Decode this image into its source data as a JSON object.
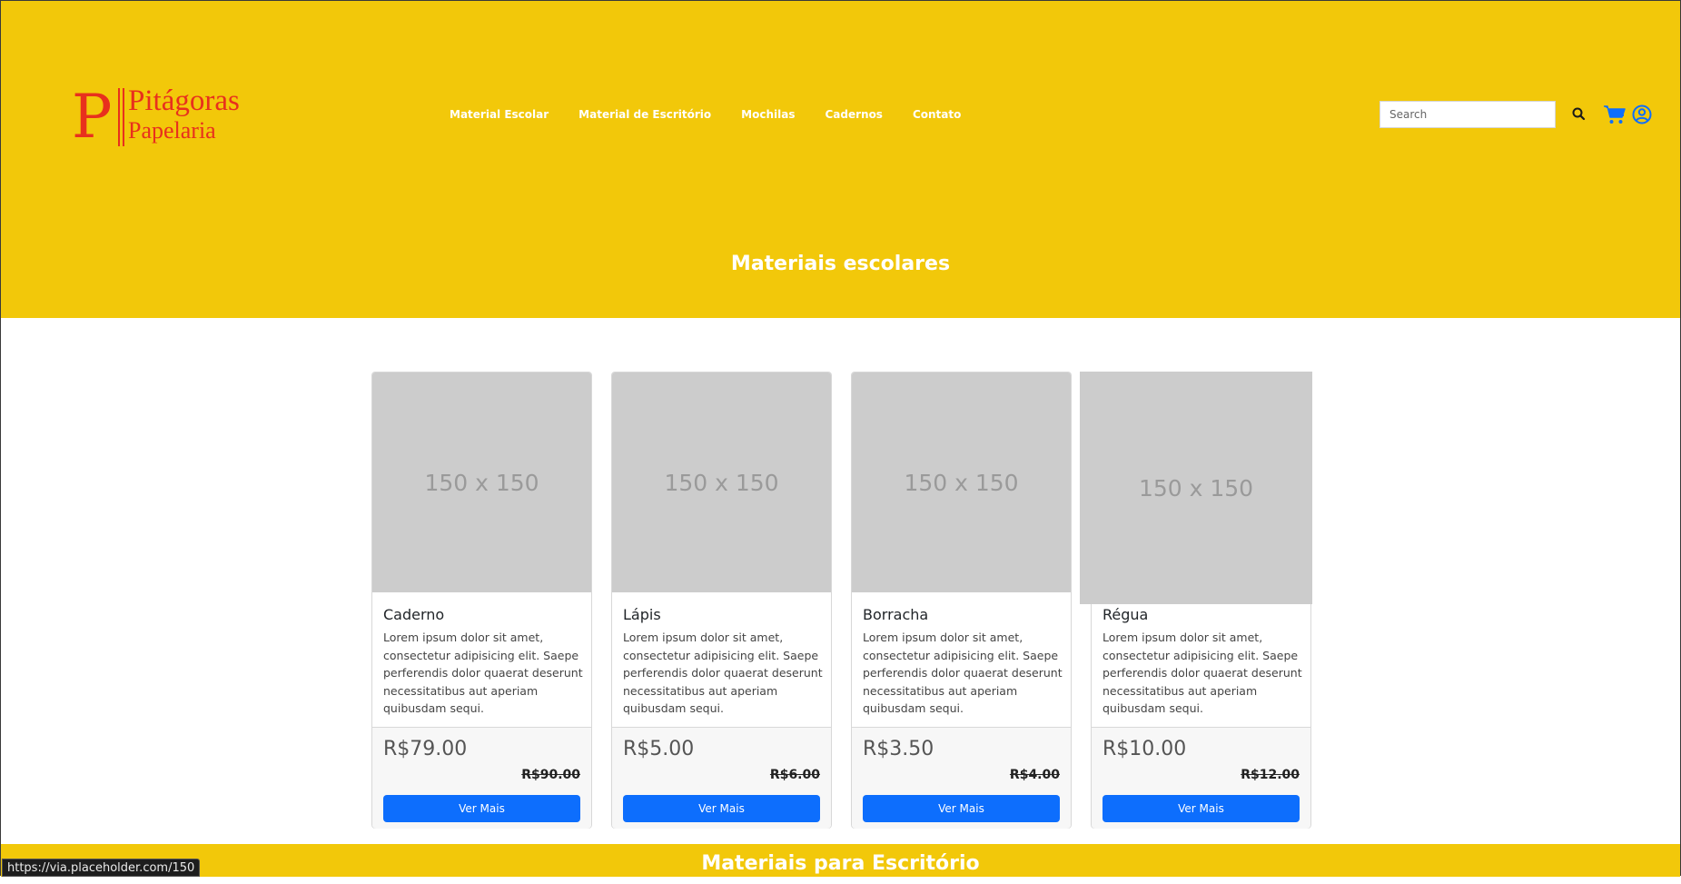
{
  "brand": {
    "letter": "P",
    "line1": "Pitágoras",
    "line2": "Papelaria",
    "color": "#e8301d"
  },
  "nav": {
    "items": [
      {
        "label": "Material Escolar"
      },
      {
        "label": "Material de Escritório"
      },
      {
        "label": "Mochilas"
      },
      {
        "label": "Cadernos"
      },
      {
        "label": "Contato"
      }
    ]
  },
  "search": {
    "placeholder": "Search",
    "value": ""
  },
  "icons": {
    "search": "search-icon",
    "cart": "cart-icon",
    "user": "user-circle-icon"
  },
  "hero": {
    "title": "Materiais escolares",
    "color": "#f2c80a"
  },
  "products": [
    {
      "image_text": "150 x 150",
      "title": "Caderno",
      "description": "Lorem ipsum dolor sit amet, consectetur adipisicing elit. Saepe perferendis dolor quaerat deserunt necessitatibus aut aperiam quibusdam sequi.",
      "price": "R$79.00",
      "old_price": "R$90.00",
      "button": "Ver Mais"
    },
    {
      "image_text": "150 x 150",
      "title": "Lápis",
      "description": "Lorem ipsum dolor sit amet, consectetur adipisicing elit. Saepe perferendis dolor quaerat deserunt necessitatibus aut aperiam quibusdam sequi.",
      "price": "R$5.00",
      "old_price": "R$6.00",
      "button": "Ver Mais"
    },
    {
      "image_text": "150 x 150",
      "title": "Borracha",
      "description": "Lorem ipsum dolor sit amet, consectetur adipisicing elit. Saepe perferendis dolor quaerat deserunt necessitatibus aut aperiam quibusdam sequi.",
      "price": "R$3.50",
      "old_price": "R$4.00",
      "button": "Ver Mais"
    },
    {
      "image_text": "150 x 150",
      "title": "Régua",
      "description": "Lorem ipsum dolor sit amet, consectetur adipisicing elit. Saepe perferendis dolor quaerat deserunt necessitatibus aut aperiam quibusdam sequi.",
      "price": "R$10.00",
      "old_price": "R$12.00",
      "button": "Ver Mais"
    }
  ],
  "section2": {
    "title": "Materiais para Escritório"
  },
  "status_bar": {
    "url": "https://via.placeholder.com/150"
  },
  "colors": {
    "accent": "#f2c80a",
    "button": "#0d6efd",
    "icon": "#0d6efd"
  }
}
